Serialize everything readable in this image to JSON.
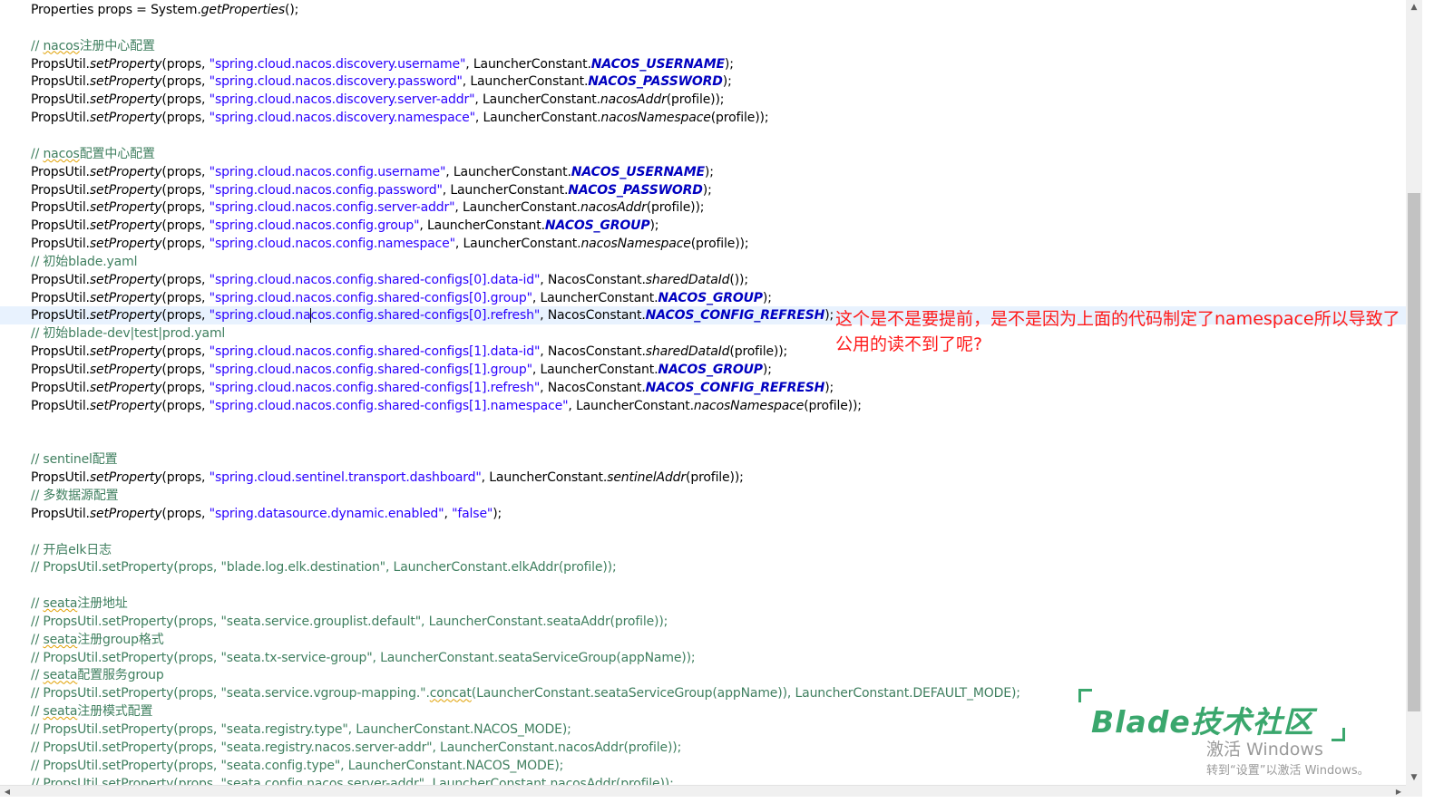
{
  "code_lines": [
    {
      "text": "Properties props = System.getProperties();",
      "tokens": [
        {
          "t": "Properties props = System."
        },
        {
          "t": "getProperties",
          "c": "t-method"
        },
        {
          "t": "();"
        }
      ]
    },
    {
      "text": "",
      "tokens": []
    },
    {
      "text": "// nacos注册中心配置",
      "tokens": [
        {
          "t": "// ",
          "c": "t-comment"
        },
        {
          "t": "nacos",
          "c": "t-comment t-squig"
        },
        {
          "t": "注册中心配置",
          "c": "t-comment"
        }
      ]
    },
    {
      "text": "PropsUtil.setProperty(props, \"spring.cloud.nacos.discovery.username\", LauncherConstant.NACOS_USERNAME);",
      "tokens": [
        {
          "t": "PropsUtil."
        },
        {
          "t": "setProperty",
          "c": "t-method"
        },
        {
          "t": "(props, "
        },
        {
          "t": "\"spring.cloud.nacos.discovery.username\"",
          "c": "t-string"
        },
        {
          "t": ", LauncherConstant."
        },
        {
          "t": "NACOS_USERNAME",
          "c": "t-const"
        },
        {
          "t": ");"
        }
      ]
    },
    {
      "text": "PropsUtil.setProperty(props, \"spring.cloud.nacos.discovery.password\", LauncherConstant.NACOS_PASSWORD);",
      "tokens": [
        {
          "t": "PropsUtil."
        },
        {
          "t": "setProperty",
          "c": "t-method"
        },
        {
          "t": "(props, "
        },
        {
          "t": "\"spring.cloud.nacos.discovery.password\"",
          "c": "t-string"
        },
        {
          "t": ", LauncherConstant."
        },
        {
          "t": "NACOS_PASSWORD",
          "c": "t-const"
        },
        {
          "t": ");"
        }
      ]
    },
    {
      "text": "PropsUtil.setProperty(props, \"spring.cloud.nacos.discovery.server-addr\", LauncherConstant.nacosAddr(profile));",
      "tokens": [
        {
          "t": "PropsUtil."
        },
        {
          "t": "setProperty",
          "c": "t-method"
        },
        {
          "t": "(props, "
        },
        {
          "t": "\"spring.cloud.nacos.discovery.server-addr\"",
          "c": "t-string"
        },
        {
          "t": ", LauncherConstant."
        },
        {
          "t": "nacosAddr",
          "c": "t-method"
        },
        {
          "t": "(profile));"
        }
      ]
    },
    {
      "text": "PropsUtil.setProperty(props, \"spring.cloud.nacos.discovery.namespace\", LauncherConstant.nacosNamespace(profile));",
      "tokens": [
        {
          "t": "PropsUtil."
        },
        {
          "t": "setProperty",
          "c": "t-method"
        },
        {
          "t": "(props, "
        },
        {
          "t": "\"spring.cloud.nacos.discovery.namespace\"",
          "c": "t-string"
        },
        {
          "t": ", LauncherConstant."
        },
        {
          "t": "nacosNamespace",
          "c": "t-method"
        },
        {
          "t": "(profile));"
        }
      ]
    },
    {
      "text": "",
      "tokens": []
    },
    {
      "text": "// nacos配置中心配置",
      "tokens": [
        {
          "t": "// ",
          "c": "t-comment"
        },
        {
          "t": "nacos",
          "c": "t-comment t-squig"
        },
        {
          "t": "配置中心配置",
          "c": "t-comment"
        }
      ]
    },
    {
      "text": "PropsUtil.setProperty(props, \"spring.cloud.nacos.config.username\", LauncherConstant.NACOS_USERNAME);",
      "tokens": [
        {
          "t": "PropsUtil."
        },
        {
          "t": "setProperty",
          "c": "t-method"
        },
        {
          "t": "(props, "
        },
        {
          "t": "\"spring.cloud.nacos.config.username\"",
          "c": "t-string"
        },
        {
          "t": ", LauncherConstant."
        },
        {
          "t": "NACOS_USERNAME",
          "c": "t-const"
        },
        {
          "t": ");"
        }
      ]
    },
    {
      "text": "PropsUtil.setProperty(props, \"spring.cloud.nacos.config.password\", LauncherConstant.NACOS_PASSWORD);",
      "tokens": [
        {
          "t": "PropsUtil."
        },
        {
          "t": "setProperty",
          "c": "t-method"
        },
        {
          "t": "(props, "
        },
        {
          "t": "\"spring.cloud.nacos.config.password\"",
          "c": "t-string"
        },
        {
          "t": ", LauncherConstant."
        },
        {
          "t": "NACOS_PASSWORD",
          "c": "t-const"
        },
        {
          "t": ");"
        }
      ]
    },
    {
      "text": "PropsUtil.setProperty(props, \"spring.cloud.nacos.config.server-addr\", LauncherConstant.nacosAddr(profile));",
      "tokens": [
        {
          "t": "PropsUtil."
        },
        {
          "t": "setProperty",
          "c": "t-method"
        },
        {
          "t": "(props, "
        },
        {
          "t": "\"spring.cloud.nacos.config.server-addr\"",
          "c": "t-string"
        },
        {
          "t": ", LauncherConstant."
        },
        {
          "t": "nacosAddr",
          "c": "t-method"
        },
        {
          "t": "(profile));"
        }
      ]
    },
    {
      "text": "PropsUtil.setProperty(props, \"spring.cloud.nacos.config.group\", LauncherConstant.NACOS_GROUP);",
      "tokens": [
        {
          "t": "PropsUtil."
        },
        {
          "t": "setProperty",
          "c": "t-method"
        },
        {
          "t": "(props, "
        },
        {
          "t": "\"spring.cloud.nacos.config.group\"",
          "c": "t-string"
        },
        {
          "t": ", LauncherConstant."
        },
        {
          "t": "NACOS_GROUP",
          "c": "t-const"
        },
        {
          "t": ");"
        }
      ]
    },
    {
      "text": "PropsUtil.setProperty(props, \"spring.cloud.nacos.config.namespace\", LauncherConstant.nacosNamespace(profile));",
      "tokens": [
        {
          "t": "PropsUtil."
        },
        {
          "t": "setProperty",
          "c": "t-method"
        },
        {
          "t": "(props, "
        },
        {
          "t": "\"spring.cloud.nacos.config.namespace\"",
          "c": "t-string"
        },
        {
          "t": ", LauncherConstant."
        },
        {
          "t": "nacosNamespace",
          "c": "t-method"
        },
        {
          "t": "(profile));"
        }
      ]
    },
    {
      "text": "// 初始blade.yaml",
      "tokens": [
        {
          "t": "// 初始blade.yaml",
          "c": "t-comment"
        }
      ]
    },
    {
      "text": "PropsUtil.setProperty(props, \"spring.cloud.nacos.config.shared-configs[0].data-id\", NacosConstant.sharedDataId());",
      "tokens": [
        {
          "t": "PropsUtil."
        },
        {
          "t": "setProperty",
          "c": "t-method"
        },
        {
          "t": "(props, "
        },
        {
          "t": "\"spring.cloud.nacos.config.shared-configs[0].data-id\"",
          "c": "t-string"
        },
        {
          "t": ", NacosConstant."
        },
        {
          "t": "sharedDataId",
          "c": "t-method"
        },
        {
          "t": "());"
        }
      ]
    },
    {
      "text": "PropsUtil.setProperty(props, \"spring.cloud.nacos.config.shared-configs[0].group\", LauncherConstant.NACOS_GROUP);",
      "tokens": [
        {
          "t": "PropsUtil."
        },
        {
          "t": "setProperty",
          "c": "t-method"
        },
        {
          "t": "(props, "
        },
        {
          "t": "\"spring.cloud.nacos.config.shared-configs[0].group\"",
          "c": "t-string"
        },
        {
          "t": ", LauncherConstant."
        },
        {
          "t": "NACOS_GROUP",
          "c": "t-const"
        },
        {
          "t": ");"
        }
      ]
    },
    {
      "text": "PropsUtil.setProperty(props, \"spring.cloud.nacos.config.shared-configs[0].refresh\", NacosConstant.NACOS_CONFIG_REFRESH);",
      "current": true,
      "tokens": [
        {
          "t": "PropsUtil."
        },
        {
          "t": "setProperty",
          "c": "t-method"
        },
        {
          "t": "(props, "
        },
        {
          "t": "\"spring.cloud.na",
          "c": "t-string"
        },
        {
          "caret": true
        },
        {
          "t": "cos.config.shared-configs[0].refresh\"",
          "c": "t-string"
        },
        {
          "t": ", NacosConstant."
        },
        {
          "t": "NACOS_CONFIG_REFRESH",
          "c": "t-const"
        },
        {
          "t": ");"
        }
      ]
    },
    {
      "text": "// 初始blade-dev|test|prod.yaml",
      "tokens": [
        {
          "t": "// 初始blade-dev|test|prod.yaml",
          "c": "t-comment"
        }
      ]
    },
    {
      "text": "PropsUtil.setProperty(props, \"spring.cloud.nacos.config.shared-configs[1].data-id\", NacosConstant.sharedDataId(profile));",
      "tokens": [
        {
          "t": "PropsUtil."
        },
        {
          "t": "setProperty",
          "c": "t-method"
        },
        {
          "t": "(props, "
        },
        {
          "t": "\"spring.cloud.nacos.config.shared-configs[1].data-id\"",
          "c": "t-string"
        },
        {
          "t": ", NacosConstant."
        },
        {
          "t": "sharedDataId",
          "c": "t-method"
        },
        {
          "t": "(profile));"
        }
      ]
    },
    {
      "text": "PropsUtil.setProperty(props, \"spring.cloud.nacos.config.shared-configs[1].group\", LauncherConstant.NACOS_GROUP);",
      "tokens": [
        {
          "t": "PropsUtil."
        },
        {
          "t": "setProperty",
          "c": "t-method"
        },
        {
          "t": "(props, "
        },
        {
          "t": "\"spring.cloud.nacos.config.shared-configs[1].group\"",
          "c": "t-string"
        },
        {
          "t": ", LauncherConstant."
        },
        {
          "t": "NACOS_GROUP",
          "c": "t-const"
        },
        {
          "t": ");"
        }
      ]
    },
    {
      "text": "PropsUtil.setProperty(props, \"spring.cloud.nacos.config.shared-configs[1].refresh\", NacosConstant.NACOS_CONFIG_REFRESH);",
      "tokens": [
        {
          "t": "PropsUtil."
        },
        {
          "t": "setProperty",
          "c": "t-method"
        },
        {
          "t": "(props, "
        },
        {
          "t": "\"spring.cloud.nacos.config.shared-configs[1].refresh\"",
          "c": "t-string"
        },
        {
          "t": ", NacosConstant."
        },
        {
          "t": "NACOS_CONFIG_REFRESH",
          "c": "t-const"
        },
        {
          "t": ");"
        }
      ]
    },
    {
      "text": "PropsUtil.setProperty(props, \"spring.cloud.nacos.config.shared-configs[1].namespace\", LauncherConstant.nacosNamespace(profile));",
      "tokens": [
        {
          "t": "PropsUtil."
        },
        {
          "t": "setProperty",
          "c": "t-method"
        },
        {
          "t": "(props, "
        },
        {
          "t": "\"spring.cloud.nacos.config.shared-configs[1].namespace\"",
          "c": "t-string"
        },
        {
          "t": ", LauncherConstant."
        },
        {
          "t": "nacosNamespace",
          "c": "t-method"
        },
        {
          "t": "(profile));"
        }
      ]
    },
    {
      "text": "",
      "tokens": []
    },
    {
      "text": "",
      "tokens": []
    },
    {
      "text": "// sentinel配置",
      "tokens": [
        {
          "t": "// sentinel配置",
          "c": "t-comment"
        }
      ]
    },
    {
      "text": "PropsUtil.setProperty(props, \"spring.cloud.sentinel.transport.dashboard\", LauncherConstant.sentinelAddr(profile));",
      "tokens": [
        {
          "t": "PropsUtil."
        },
        {
          "t": "setProperty",
          "c": "t-method"
        },
        {
          "t": "(props, "
        },
        {
          "t": "\"spring.cloud.sentinel.transport.dashboard\"",
          "c": "t-string"
        },
        {
          "t": ", LauncherConstant."
        },
        {
          "t": "sentinelAddr",
          "c": "t-method"
        },
        {
          "t": "(profile));"
        }
      ]
    },
    {
      "text": "// 多数据源配置",
      "tokens": [
        {
          "t": "// 多数据源配置",
          "c": "t-comment"
        }
      ]
    },
    {
      "text": "PropsUtil.setProperty(props, \"spring.datasource.dynamic.enabled\", \"false\");",
      "tokens": [
        {
          "t": "PropsUtil."
        },
        {
          "t": "setProperty",
          "c": "t-method"
        },
        {
          "t": "(props, "
        },
        {
          "t": "\"spring.datasource.dynamic.enabled\"",
          "c": "t-string"
        },
        {
          "t": ", "
        },
        {
          "t": "\"false\"",
          "c": "t-string"
        },
        {
          "t": ");"
        }
      ]
    },
    {
      "text": "",
      "tokens": []
    },
    {
      "text": "// 开启elk日志",
      "tokens": [
        {
          "t": "// 开启elk日志",
          "c": "t-comment"
        }
      ]
    },
    {
      "text": "// PropsUtil.setProperty(props, \"blade.log.elk.destination\", LauncherConstant.elkAddr(profile));",
      "tokens": [
        {
          "t": "// PropsUtil.setProperty(props, \"blade.log.elk.destination\", LauncherConstant.elkAddr(profile));",
          "c": "t-comment"
        }
      ]
    },
    {
      "text": "",
      "tokens": []
    },
    {
      "text": "// seata注册地址",
      "tokens": [
        {
          "t": "// ",
          "c": "t-comment"
        },
        {
          "t": "seata",
          "c": "t-comment t-squig"
        },
        {
          "t": "注册地址",
          "c": "t-comment"
        }
      ]
    },
    {
      "text": "// PropsUtil.setProperty(props, \"seata.service.grouplist.default\", LauncherConstant.seataAddr(profile));",
      "tokens": [
        {
          "t": "// PropsUtil.setProperty(props, \"seata.service.grouplist.default\", LauncherConstant.seataAddr(profile));",
          "c": "t-comment"
        }
      ]
    },
    {
      "text": "// seata注册group格式",
      "tokens": [
        {
          "t": "// ",
          "c": "t-comment"
        },
        {
          "t": "seata",
          "c": "t-comment t-squig"
        },
        {
          "t": "注册group格式",
          "c": "t-comment"
        }
      ]
    },
    {
      "text": "// PropsUtil.setProperty(props, \"seata.tx-service-group\", LauncherConstant.seataServiceGroup(appName));",
      "tokens": [
        {
          "t": "// PropsUtil.setProperty(props, \"seata.tx-service-group\", LauncherConstant.seataServiceGroup(appName));",
          "c": "t-comment"
        }
      ]
    },
    {
      "text": "// seata配置服务group",
      "tokens": [
        {
          "t": "// ",
          "c": "t-comment"
        },
        {
          "t": "seata",
          "c": "t-comment t-squig"
        },
        {
          "t": "配置服务group",
          "c": "t-comment"
        }
      ]
    },
    {
      "text": "// PropsUtil.setProperty(props, \"seata.service.vgroup-mapping.\".concat(LauncherConstant.seataServiceGroup(appName)), LauncherConstant.DEFAULT_MODE);",
      "tokens": [
        {
          "t": "// PropsUtil.setProperty(props, \"seata.service.vgroup-mapping.\".",
          "c": "t-comment"
        },
        {
          "t": "concat",
          "c": "t-comment t-squig"
        },
        {
          "t": "(LauncherConstant.seataServiceGroup(appName)), LauncherConstant.DEFAULT_MODE);",
          "c": "t-comment"
        }
      ]
    },
    {
      "text": "// seata注册模式配置",
      "tokens": [
        {
          "t": "// ",
          "c": "t-comment"
        },
        {
          "t": "seata",
          "c": "t-comment t-squig"
        },
        {
          "t": "注册模式配置",
          "c": "t-comment"
        }
      ]
    },
    {
      "text": "// PropsUtil.setProperty(props, \"seata.registry.type\", LauncherConstant.NACOS_MODE);",
      "tokens": [
        {
          "t": "// PropsUtil.setProperty(props, \"seata.registry.type\", LauncherConstant.NACOS_MODE);",
          "c": "t-comment"
        }
      ]
    },
    {
      "text": "// PropsUtil.setProperty(props, \"seata.registry.nacos.server-addr\", LauncherConstant.nacosAddr(profile));",
      "tokens": [
        {
          "t": "// PropsUtil.setProperty(props, \"seata.registry.nacos.server-addr\", LauncherConstant.nacosAddr(profile));",
          "c": "t-comment"
        }
      ]
    },
    {
      "text": "// PropsUtil.setProperty(props, \"seata.config.type\", LauncherConstant.NACOS_MODE);",
      "tokens": [
        {
          "t": "// PropsUtil.setProperty(props, \"seata.config.type\", LauncherConstant.NACOS_MODE);",
          "c": "t-comment"
        }
      ]
    },
    {
      "text": "// PropsUtil.setProperty(props, \"seata.config.nacos.server-addr\", LauncherConstant.nacosAddr(profile));",
      "tokens": [
        {
          "t": "// PropsUtil.setProperty(props, \"seata.config.nacos.server-addr\", LauncherConstant.nacosAddr(profile));",
          "c": "t-comment"
        }
      ]
    }
  ],
  "annotation": {
    "text": "这个是不是要提前，是不是因为上面的代码制定了namespace所以导致了公用的读不到了呢?",
    "color": "#ff1a1a"
  },
  "watermark": {
    "text": "Blade技术社区",
    "color": "#3aa76d"
  },
  "os_overlay": {
    "activate_title": "激活 Windows",
    "activate_subtitle": "转到“设置”以激活 Windows。"
  },
  "scrollbars": {
    "vertical_up_icon": "▲",
    "vertical_down_icon": "▼",
    "horizontal_left_icon": "◀",
    "horizontal_right_icon": "▶"
  },
  "colors": {
    "comment": "#3f7f5f",
    "string": "#2a00ff",
    "constant": "#0000c0",
    "current_line": "#e8f2fe"
  }
}
